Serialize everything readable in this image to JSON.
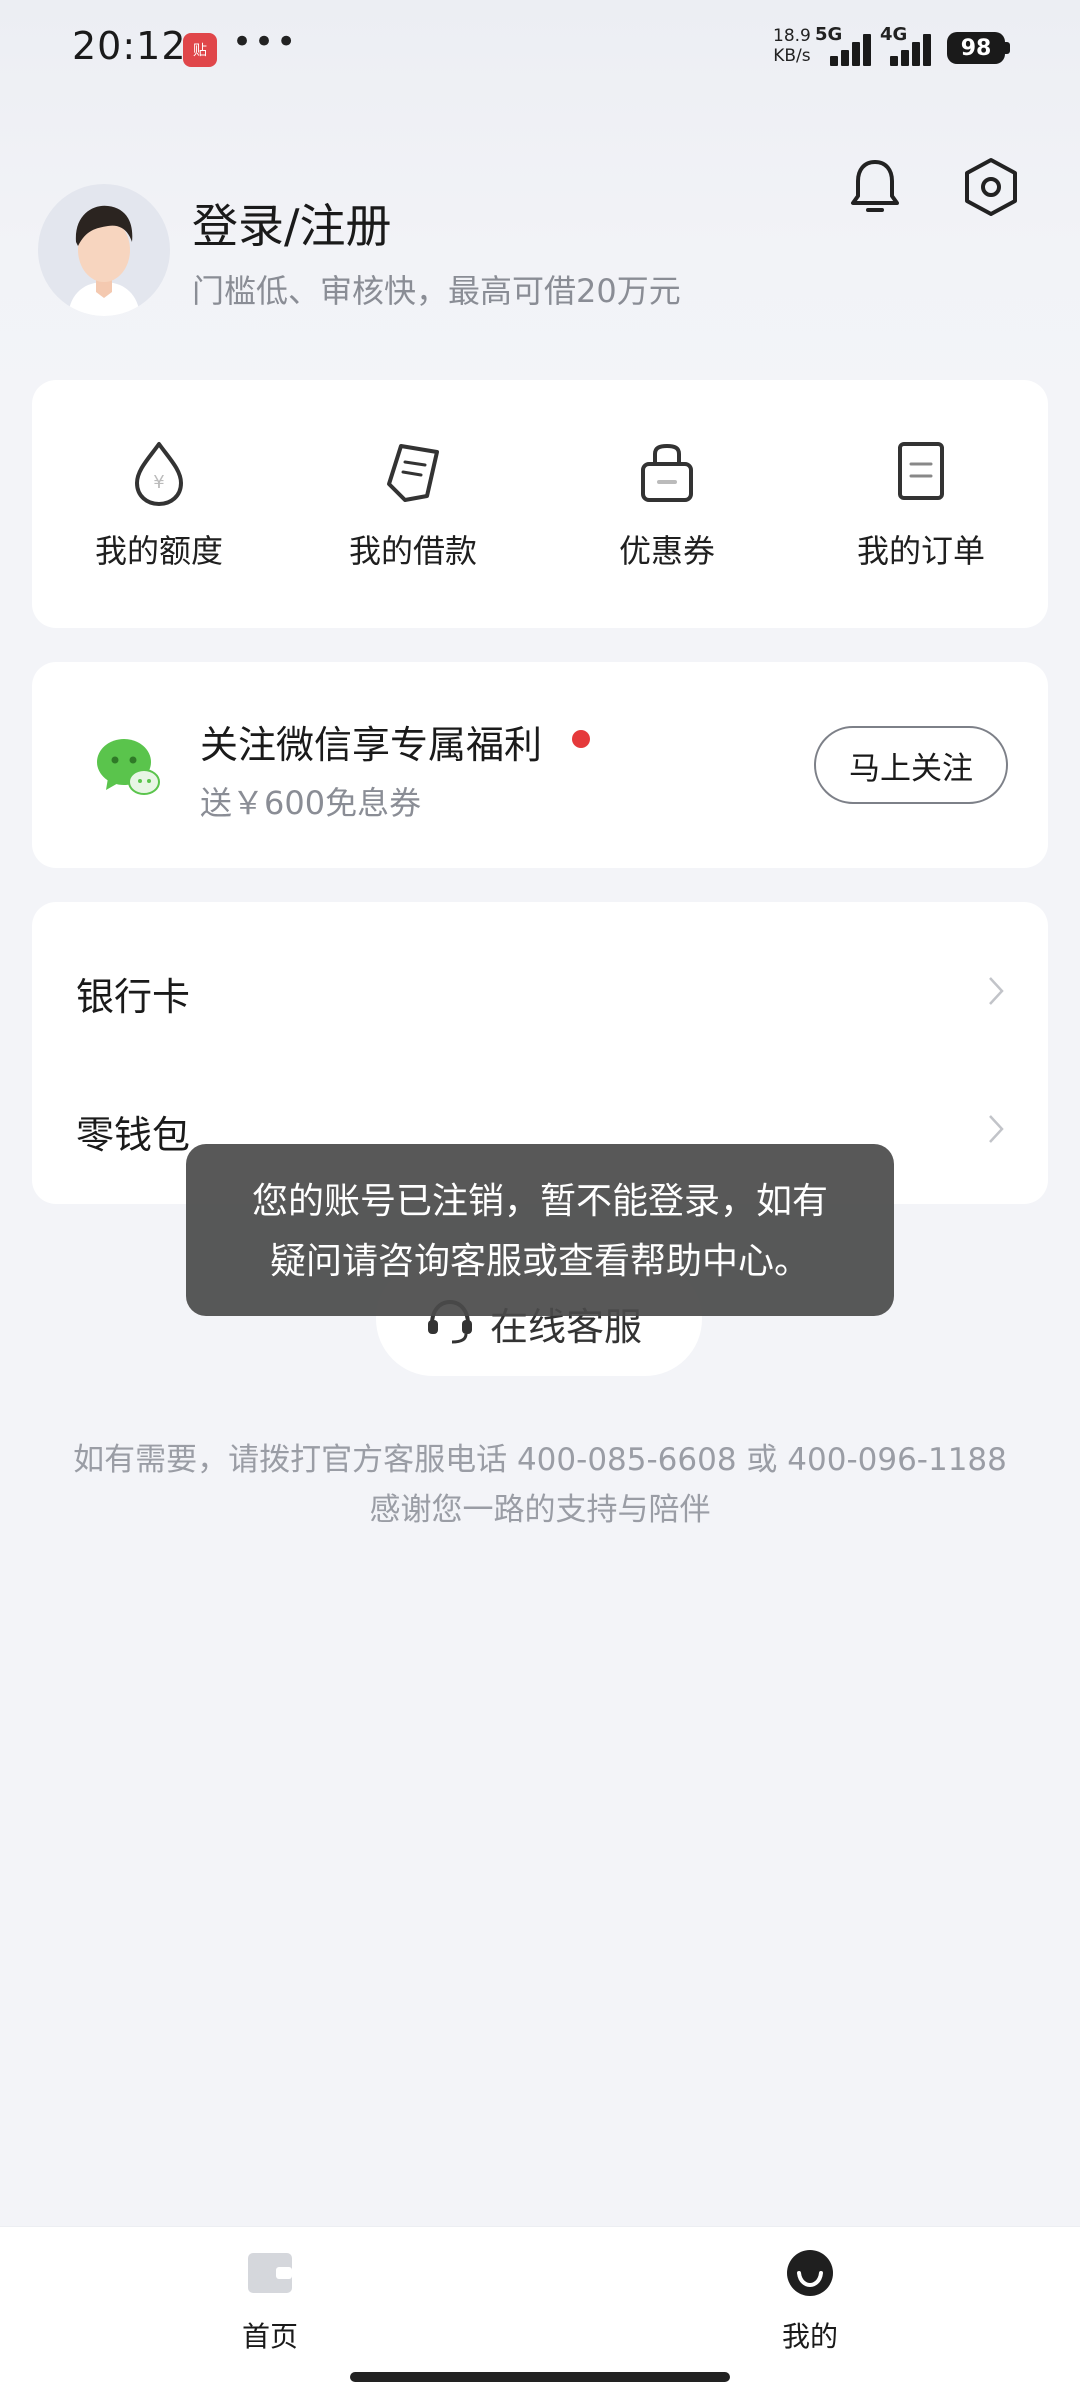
{
  "status_bar": {
    "time": "20:12",
    "app_badge": "贴",
    "more": "•••",
    "net_speed_value": "18.9",
    "net_speed_unit": "KB/s",
    "network_1": "5G",
    "network_2": "4G",
    "battery": "98"
  },
  "header": {
    "title": "登录/注册",
    "subtitle": "门槛低、审核快，最高可借20万元",
    "icons": [
      "bell-icon",
      "settings-icon"
    ]
  },
  "quick_actions": [
    {
      "label": "我的额度",
      "icon": "credit-drop-icon"
    },
    {
      "label": "我的借款",
      "icon": "loan-note-icon"
    },
    {
      "label": "优惠券",
      "icon": "coupon-bag-icon"
    },
    {
      "label": "我的订单",
      "icon": "order-doc-icon"
    }
  ],
  "wechat_promo": {
    "title": "关注微信享专属福利",
    "subtitle": "送￥600免息券",
    "button": "马上关注"
  },
  "menu": [
    {
      "label": "银行卡"
    },
    {
      "label": "零钱包"
    }
  ],
  "service": {
    "label": "在线客服"
  },
  "hint": {
    "line1": "如有需要，请拨打官方客服电话 400-085-6608 或 400-096-1188",
    "line2": "感谢您一路的支持与陪伴"
  },
  "toast": {
    "line1": "您的账号已注销，暂不能登录，如有",
    "line2": "疑问请咨询客服或查看帮助中心。"
  },
  "bottom_nav": [
    {
      "label": "首页",
      "icon": "home-wallet-icon",
      "active": false
    },
    {
      "label": "我的",
      "icon": "profile-smile-icon",
      "active": true
    }
  ],
  "colors": {
    "background": "#f3f4f8",
    "accent_red": "#e5393b",
    "wechat_green": "#5ac44c",
    "toast_bg": "#4a4a4a"
  }
}
